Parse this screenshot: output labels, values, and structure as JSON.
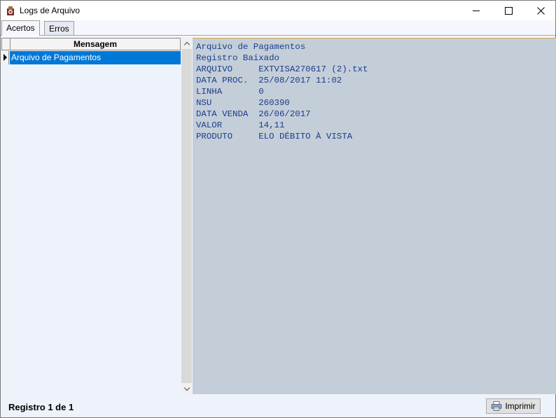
{
  "window": {
    "title": "Logs de Arquivo",
    "icon": "app-icon"
  },
  "tabs": [
    {
      "label": "Acertos",
      "active": true
    },
    {
      "label": "Erros",
      "active": false
    }
  ],
  "grid": {
    "column_header": "Mensagem",
    "rows": [
      {
        "text": "Arquivo de Pagamentos",
        "selected": true
      }
    ]
  },
  "log": {
    "lines": [
      "Arquivo de Pagamentos",
      "Registro Baixado",
      "ARQUIVO     EXTVISA270617 (2).txt",
      "DATA PROC.  25/08/2017 11:02",
      "LINHA       0",
      "NSU         260390",
      "DATA VENDA  26/06/2017",
      "VALOR       14,11",
      "PRODUTO     ELO DÉBITO À VISTA"
    ]
  },
  "footer": {
    "record_status": "Registro 1 de 1",
    "print_label": "Imprimir"
  },
  "colors": {
    "selection": "#0078d7",
    "log_background": "#c4ced9",
    "log_text": "#1a3d8c"
  }
}
